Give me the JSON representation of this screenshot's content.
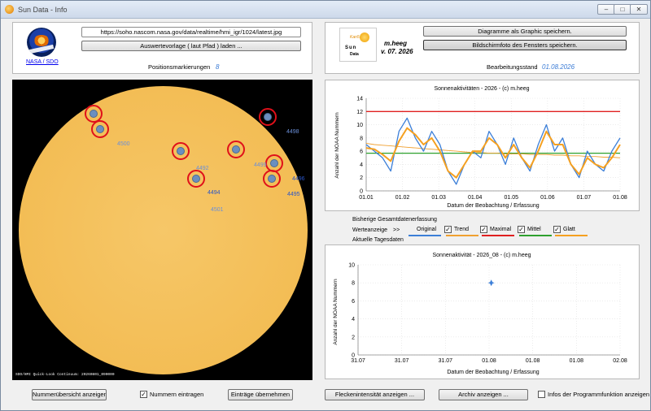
{
  "window": {
    "title": "Sun Data - Info",
    "minimize": "–",
    "maximize": "□",
    "close": "✕"
  },
  "source": {
    "logo_caption": "NASA / SDO",
    "url": "https://soho.nascom.nasa.gov/data/realtime/hmi_igr/1024/latest.jpg",
    "load_button": "Auswertevorlage ( laut Pfad ) laden ...",
    "markers_label": "Positionsmarkierungen",
    "markers_value": "8"
  },
  "program": {
    "logo_line1": "Sun",
    "logo_line2": "Data",
    "logo_badge": "Kan5",
    "author": "m.heeg",
    "version": "v. 07. 2026",
    "save_chart_button": "Diagramme als Graphic speichern.",
    "screenshot_button": "Bildschirmfoto des Fensters speichern.",
    "status_label": "Bearbeitungsstand",
    "status_value": "01.08.2026"
  },
  "sun_image": {
    "caption": "SDO/HMI Quick-Look Continuum: 20260801_090000",
    "spots": [
      {
        "number": ""
      },
      {
        "number": "4500"
      },
      {
        "number": "4498"
      },
      {
        "number": "4492"
      },
      {
        "number": "4499"
      },
      {
        "number": "4496"
      },
      {
        "number": "4495"
      },
      {
        "number": "4494"
      },
      {
        "number": "4501"
      }
    ]
  },
  "chart_data": [
    {
      "type": "line",
      "title": "Sonnenaktivitäten - 2026 - (c) m.heeg",
      "xlabel": "Datum der Beobachtung / Erfassung",
      "ylabel": "Anzahl der NOAA Nummern",
      "x_ticks": [
        "01.01",
        "01.02",
        "01.03",
        "01.04",
        "01.05",
        "01.06",
        "01.07",
        "01.08"
      ],
      "y_ticks": [
        "0",
        "2",
        "4",
        "6",
        "8",
        "10",
        "12",
        "14"
      ],
      "ylim": [
        0,
        14
      ],
      "x_dates": [
        "01.01",
        "07.01",
        "14.01",
        "21.01",
        "28.01",
        "04.02",
        "11.02",
        "18.02",
        "25.02",
        "04.03",
        "11.03",
        "18.03",
        "25.03",
        "01.04",
        "08.04",
        "15.04",
        "22.04",
        "29.04",
        "06.05",
        "13.05",
        "20.05",
        "27.05",
        "03.06",
        "10.06",
        "17.06",
        "24.06",
        "01.07",
        "08.07",
        "15.07",
        "22.07",
        "29.07",
        "01.08"
      ],
      "series": [
        {
          "name": "Original",
          "color": "#3c7fd8",
          "values": [
            7,
            6,
            5,
            3,
            9,
            11,
            8,
            6,
            9,
            7,
            3,
            1,
            4,
            6,
            5,
            9,
            7,
            4,
            8,
            5,
            3,
            7,
            10,
            6,
            8,
            4,
            2,
            6,
            4,
            3,
            6,
            8
          ]
        },
        {
          "name": "Trend",
          "color": "#f0a030",
          "values": [
            7.2,
            7.0,
            6.9,
            6.8,
            6.7,
            6.6,
            6.5,
            6.4,
            6.3,
            6.2,
            6.1,
            6.0,
            5.9,
            5.8,
            5.8,
            5.7,
            5.7,
            5.6,
            5.6,
            5.6,
            5.5,
            5.5,
            5.5,
            5.4,
            5.4,
            5.3,
            5.3,
            5.2,
            5.2,
            5.1,
            5.1,
            5.0
          ]
        },
        {
          "name": "Maximal",
          "color": "#e02020",
          "values": [
            12,
            12,
            12,
            12,
            12,
            12,
            12,
            12,
            12,
            12,
            12,
            12,
            12,
            12,
            12,
            12,
            12,
            12,
            12,
            12,
            12,
            12,
            12,
            12,
            12,
            12,
            12,
            12,
            12,
            12,
            12,
            12
          ]
        },
        {
          "name": "Mittel",
          "color": "#2ea02e",
          "values": [
            5.7,
            5.7,
            5.7,
            5.7,
            5.7,
            5.7,
            5.7,
            5.7,
            5.7,
            5.7,
            5.7,
            5.7,
            5.7,
            5.7,
            5.7,
            5.7,
            5.7,
            5.7,
            5.7,
            5.7,
            5.7,
            5.7,
            5.7,
            5.7,
            5.7,
            5.7,
            5.7,
            5.7,
            5.7,
            5.7,
            5.7,
            5.7
          ]
        },
        {
          "name": "Glatt",
          "color": "#f5a020",
          "values": [
            6.5,
            6.3,
            5.5,
            4.5,
            7.5,
            9.5,
            8.5,
            7,
            8,
            6,
            3,
            2,
            4,
            6,
            6,
            8,
            7,
            5,
            7,
            5,
            3.5,
            6,
            9,
            7,
            7,
            4,
            2.5,
            5,
            4,
            3.5,
            5,
            7
          ]
        }
      ]
    },
    {
      "type": "scatter",
      "title": "Sonnenaktivität - 2026_08 - (c) m.heeg",
      "xlabel": "Datum der Beobachtung / Erfassung",
      "ylabel": "Anzahl der NOAA Nummern",
      "x_ticks": [
        "31.07",
        "31.07",
        "31.07",
        "01.08",
        "01.08",
        "01.08",
        "02.08"
      ],
      "y_ticks": [
        "0",
        "2",
        "4",
        "6",
        "8",
        "10"
      ],
      "ylim": [
        0,
        10
      ],
      "points": [
        {
          "x": "01.08",
          "y": 8
        }
      ]
    }
  ],
  "legend": {
    "history_label": "Bisherige Gesamtdatenerfassung",
    "display_label": "Werteanzeige",
    "arrow": ">>",
    "daily_label": "Aktuelle Tagesdaten",
    "items": [
      {
        "name": "Original",
        "checked": false
      },
      {
        "name": "Trend",
        "checked": true
      },
      {
        "name": "Maximal",
        "checked": true
      },
      {
        "name": "Mittel",
        "checked": true
      },
      {
        "name": "Glatt",
        "checked": true
      }
    ]
  },
  "bottom": {
    "numbers_button": "Nummerübersicht anzeigen",
    "enter_numbers_label": "Nummern eintragen",
    "enter_numbers_checked": true,
    "apply_button": "Einträge übernehmen",
    "spot_intensity_button": "Fleckenintensität anzeigen ...",
    "archive_button": "Archiv anzeigen ...",
    "info_label": "Infos der Programmfunktion anzeigen",
    "info_checked": false
  }
}
